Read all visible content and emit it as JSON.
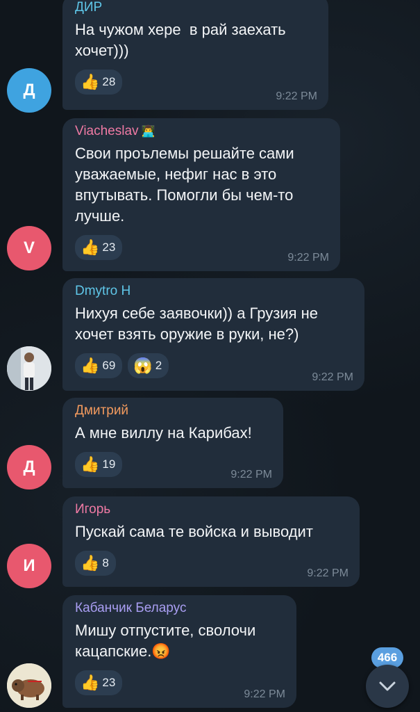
{
  "colors": {
    "bubble": "#212d3b",
    "reaction_bg": "#2c3d50",
    "time": "#7d8b99",
    "badge": "#5a9fe0"
  },
  "messages": [
    {
      "author": "ДИР",
      "author_color": "#5fc6e8",
      "avatar_letter": "Д",
      "avatar_color": "#3fa3e0",
      "text": "На чужом хере  в рай заехать\nхочет)))",
      "reactions": [
        {
          "emoji": "👍",
          "count": "28"
        }
      ],
      "time": "9:22 PM"
    },
    {
      "author": "Viacheslav",
      "author_badge": "👨‍💻",
      "author_color": "#ef7aa4",
      "avatar_letter": "V",
      "avatar_color": "#e8586e",
      "text": "Свои проълемы решайте сами\nуважаемые, нефиг нас в это\nвпутывать. Помогли бы чем-то\nлучше.",
      "reactions": [
        {
          "emoji": "👍",
          "count": "23"
        }
      ],
      "time": "9:22 PM"
    },
    {
      "author": "Dmytro H",
      "author_color": "#5fc6e8",
      "avatar_icon": "person-photo-avatar",
      "text": "Нихуя себе заявочки)) а Грузия не\nхочет взять оружие в руки, не?)",
      "reactions": [
        {
          "emoji": "👍",
          "count": "69"
        },
        {
          "emoji": "😱",
          "count": "2"
        }
      ],
      "time": "9:22 PM"
    },
    {
      "author": "Дмитрий",
      "author_color": "#f29a5e",
      "avatar_letter": "Д",
      "avatar_color": "#e8586e",
      "text": "А мне виллу на Карибах!",
      "reactions": [
        {
          "emoji": "👍",
          "count": "19"
        }
      ],
      "time": "9:22 PM"
    },
    {
      "author": "Игорь",
      "author_color": "#ef7aa4",
      "avatar_letter": "И",
      "avatar_color": "#e8586e",
      "text": "Пускай сама те войска и выводит",
      "reactions": [
        {
          "emoji": "👍",
          "count": "8"
        }
      ],
      "time": "9:22 PM"
    },
    {
      "author": "Кабанчик Беларус",
      "author_color": "#a99ef2",
      "avatar_icon": "boar-avatar",
      "text": "Мишу отпустите, сволочи\nкацапские.😡",
      "reactions": [
        {
          "emoji": "👍",
          "count": "23"
        }
      ],
      "time": "9:22 PM"
    }
  ],
  "unread_badge": "466",
  "scroll_down_icon": "chevron-down-icon"
}
